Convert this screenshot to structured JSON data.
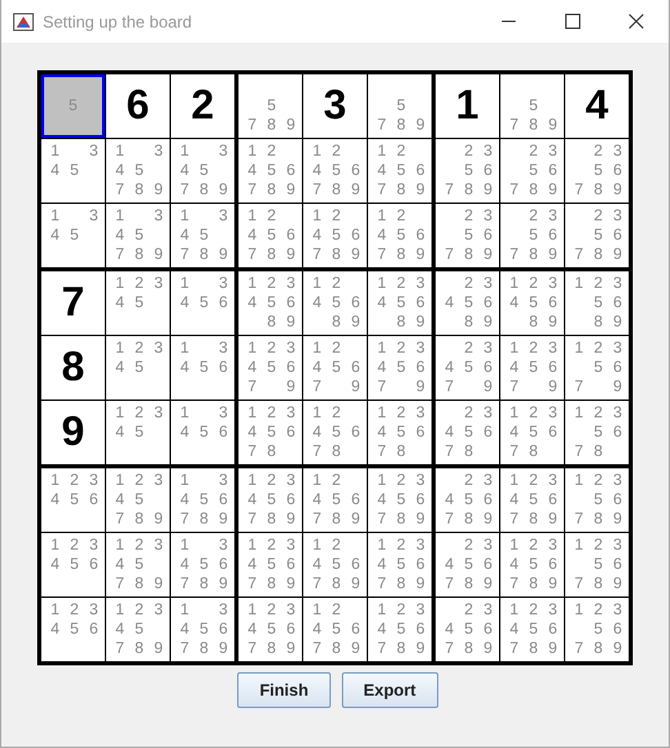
{
  "window": {
    "title": "Setting up the board"
  },
  "board": {
    "rows": [
      [
        {
          "kind": "candidates",
          "marks": [
            "5"
          ],
          "selected": true
        },
        {
          "kind": "value",
          "text": "6",
          "selected": false
        },
        {
          "kind": "value",
          "text": "2",
          "selected": false
        },
        {
          "kind": "candidates",
          "marks": [
            "5",
            "7",
            "8",
            "9"
          ],
          "selected": false
        },
        {
          "kind": "value",
          "text": "3",
          "selected": false
        },
        {
          "kind": "candidates",
          "marks": [
            "5",
            "7",
            "8",
            "9"
          ],
          "selected": false
        },
        {
          "kind": "value",
          "text": "1",
          "selected": false
        },
        {
          "kind": "candidates",
          "marks": [
            "5",
            "7",
            "8",
            "9"
          ],
          "selected": false
        },
        {
          "kind": "value",
          "text": "4",
          "selected": false
        }
      ],
      [
        {
          "kind": "candidates",
          "marks": [
            "1",
            "3",
            "4",
            "5"
          ],
          "selected": false
        },
        {
          "kind": "candidates",
          "marks": [
            "1",
            "3",
            "4",
            "5",
            "7",
            "8",
            "9"
          ],
          "selected": false
        },
        {
          "kind": "candidates",
          "marks": [
            "1",
            "3",
            "4",
            "5",
            "7",
            "8",
            "9"
          ],
          "selected": false
        },
        {
          "kind": "candidates",
          "marks": [
            "1",
            "2",
            "4",
            "5",
            "6",
            "7",
            "8",
            "9"
          ],
          "selected": false
        },
        {
          "kind": "candidates",
          "marks": [
            "1",
            "2",
            "4",
            "5",
            "6",
            "7",
            "8",
            "9"
          ],
          "selected": false
        },
        {
          "kind": "candidates",
          "marks": [
            "1",
            "2",
            "4",
            "5",
            "6",
            "7",
            "8",
            "9"
          ],
          "selected": false
        },
        {
          "kind": "candidates",
          "marks": [
            "2",
            "3",
            "5",
            "6",
            "7",
            "8",
            "9"
          ],
          "selected": false
        },
        {
          "kind": "candidates",
          "marks": [
            "2",
            "3",
            "5",
            "6",
            "7",
            "8",
            "9"
          ],
          "selected": false
        },
        {
          "kind": "candidates",
          "marks": [
            "2",
            "3",
            "5",
            "6",
            "7",
            "8",
            "9"
          ],
          "selected": false
        }
      ],
      [
        {
          "kind": "candidates",
          "marks": [
            "1",
            "3",
            "4",
            "5"
          ],
          "selected": false
        },
        {
          "kind": "candidates",
          "marks": [
            "1",
            "3",
            "4",
            "5",
            "7",
            "8",
            "9"
          ],
          "selected": false
        },
        {
          "kind": "candidates",
          "marks": [
            "1",
            "3",
            "4",
            "5",
            "7",
            "8",
            "9"
          ],
          "selected": false
        },
        {
          "kind": "candidates",
          "marks": [
            "1",
            "2",
            "4",
            "5",
            "6",
            "7",
            "8",
            "9"
          ],
          "selected": false
        },
        {
          "kind": "candidates",
          "marks": [
            "1",
            "2",
            "4",
            "5",
            "6",
            "7",
            "8",
            "9"
          ],
          "selected": false
        },
        {
          "kind": "candidates",
          "marks": [
            "1",
            "2",
            "4",
            "5",
            "6",
            "7",
            "8",
            "9"
          ],
          "selected": false
        },
        {
          "kind": "candidates",
          "marks": [
            "2",
            "3",
            "5",
            "6",
            "7",
            "8",
            "9"
          ],
          "selected": false
        },
        {
          "kind": "candidates",
          "marks": [
            "2",
            "3",
            "5",
            "6",
            "7",
            "8",
            "9"
          ],
          "selected": false
        },
        {
          "kind": "candidates",
          "marks": [
            "2",
            "3",
            "5",
            "6",
            "7",
            "8",
            "9"
          ],
          "selected": false
        }
      ],
      [
        {
          "kind": "value",
          "text": "7",
          "selected": false
        },
        {
          "kind": "candidates",
          "marks": [
            "1",
            "2",
            "3",
            "4",
            "5"
          ],
          "selected": false
        },
        {
          "kind": "candidates",
          "marks": [
            "1",
            "3",
            "4",
            "5",
            "6"
          ],
          "selected": false
        },
        {
          "kind": "candidates",
          "marks": [
            "1",
            "2",
            "3",
            "4",
            "5",
            "6",
            "8",
            "9"
          ],
          "selected": false
        },
        {
          "kind": "candidates",
          "marks": [
            "1",
            "2",
            "4",
            "5",
            "6",
            "8",
            "9"
          ],
          "selected": false
        },
        {
          "kind": "candidates",
          "marks": [
            "1",
            "2",
            "3",
            "4",
            "5",
            "6",
            "8",
            "9"
          ],
          "selected": false
        },
        {
          "kind": "candidates",
          "marks": [
            "2",
            "3",
            "4",
            "5",
            "6",
            "8",
            "9"
          ],
          "selected": false
        },
        {
          "kind": "candidates",
          "marks": [
            "1",
            "2",
            "3",
            "4",
            "5",
            "6",
            "8",
            "9"
          ],
          "selected": false
        },
        {
          "kind": "candidates",
          "marks": [
            "1",
            "2",
            "3",
            "5",
            "6",
            "8",
            "9"
          ],
          "selected": false
        }
      ],
      [
        {
          "kind": "value",
          "text": "8",
          "selected": false
        },
        {
          "kind": "candidates",
          "marks": [
            "1",
            "2",
            "3",
            "4",
            "5"
          ],
          "selected": false
        },
        {
          "kind": "candidates",
          "marks": [
            "1",
            "3",
            "4",
            "5",
            "6"
          ],
          "selected": false
        },
        {
          "kind": "candidates",
          "marks": [
            "1",
            "2",
            "3",
            "4",
            "5",
            "6",
            "7",
            "9"
          ],
          "selected": false
        },
        {
          "kind": "candidates",
          "marks": [
            "1",
            "2",
            "4",
            "5",
            "6",
            "7",
            "9"
          ],
          "selected": false
        },
        {
          "kind": "candidates",
          "marks": [
            "1",
            "2",
            "3",
            "4",
            "5",
            "6",
            "7",
            "9"
          ],
          "selected": false
        },
        {
          "kind": "candidates",
          "marks": [
            "2",
            "3",
            "4",
            "5",
            "6",
            "7",
            "9"
          ],
          "selected": false
        },
        {
          "kind": "candidates",
          "marks": [
            "1",
            "2",
            "3",
            "4",
            "5",
            "6",
            "7",
            "9"
          ],
          "selected": false
        },
        {
          "kind": "candidates",
          "marks": [
            "1",
            "2",
            "3",
            "5",
            "6",
            "7",
            "9"
          ],
          "selected": false
        }
      ],
      [
        {
          "kind": "value",
          "text": "9",
          "selected": false
        },
        {
          "kind": "candidates",
          "marks": [
            "1",
            "2",
            "3",
            "4",
            "5"
          ],
          "selected": false
        },
        {
          "kind": "candidates",
          "marks": [
            "1",
            "3",
            "4",
            "5",
            "6"
          ],
          "selected": false
        },
        {
          "kind": "candidates",
          "marks": [
            "1",
            "2",
            "3",
            "4",
            "5",
            "6",
            "7",
            "8"
          ],
          "selected": false
        },
        {
          "kind": "candidates",
          "marks": [
            "1",
            "2",
            "4",
            "5",
            "6",
            "7",
            "8"
          ],
          "selected": false
        },
        {
          "kind": "candidates",
          "marks": [
            "1",
            "2",
            "3",
            "4",
            "5",
            "6",
            "7",
            "8"
          ],
          "selected": false
        },
        {
          "kind": "candidates",
          "marks": [
            "2",
            "3",
            "4",
            "5",
            "6",
            "7",
            "8"
          ],
          "selected": false
        },
        {
          "kind": "candidates",
          "marks": [
            "1",
            "2",
            "3",
            "4",
            "5",
            "6",
            "7",
            "8"
          ],
          "selected": false
        },
        {
          "kind": "candidates",
          "marks": [
            "1",
            "2",
            "3",
            "5",
            "6",
            "7",
            "8"
          ],
          "selected": false
        }
      ],
      [
        {
          "kind": "candidates",
          "marks": [
            "1",
            "2",
            "3",
            "4",
            "5",
            "6"
          ],
          "selected": false
        },
        {
          "kind": "candidates",
          "marks": [
            "1",
            "2",
            "3",
            "4",
            "5",
            "7",
            "8",
            "9"
          ],
          "selected": false
        },
        {
          "kind": "candidates",
          "marks": [
            "1",
            "3",
            "4",
            "5",
            "6",
            "7",
            "8",
            "9"
          ],
          "selected": false
        },
        {
          "kind": "candidates",
          "marks": [
            "1",
            "2",
            "3",
            "4",
            "5",
            "6",
            "7",
            "8",
            "9"
          ],
          "selected": false
        },
        {
          "kind": "candidates",
          "marks": [
            "1",
            "2",
            "4",
            "5",
            "6",
            "7",
            "8",
            "9"
          ],
          "selected": false
        },
        {
          "kind": "candidates",
          "marks": [
            "1",
            "2",
            "3",
            "4",
            "5",
            "6",
            "7",
            "8",
            "9"
          ],
          "selected": false
        },
        {
          "kind": "candidates",
          "marks": [
            "2",
            "3",
            "4",
            "5",
            "6",
            "7",
            "8",
            "9"
          ],
          "selected": false
        },
        {
          "kind": "candidates",
          "marks": [
            "1",
            "2",
            "3",
            "4",
            "5",
            "6",
            "7",
            "8",
            "9"
          ],
          "selected": false
        },
        {
          "kind": "candidates",
          "marks": [
            "1",
            "2",
            "3",
            "5",
            "6",
            "7",
            "8",
            "9"
          ],
          "selected": false
        }
      ],
      [
        {
          "kind": "candidates",
          "marks": [
            "1",
            "2",
            "3",
            "4",
            "5",
            "6"
          ],
          "selected": false
        },
        {
          "kind": "candidates",
          "marks": [
            "1",
            "2",
            "3",
            "4",
            "5",
            "7",
            "8",
            "9"
          ],
          "selected": false
        },
        {
          "kind": "candidates",
          "marks": [
            "1",
            "3",
            "4",
            "5",
            "6",
            "7",
            "8",
            "9"
          ],
          "selected": false
        },
        {
          "kind": "candidates",
          "marks": [
            "1",
            "2",
            "3",
            "4",
            "5",
            "6",
            "7",
            "8",
            "9"
          ],
          "selected": false
        },
        {
          "kind": "candidates",
          "marks": [
            "1",
            "2",
            "4",
            "5",
            "6",
            "7",
            "8",
            "9"
          ],
          "selected": false
        },
        {
          "kind": "candidates",
          "marks": [
            "1",
            "2",
            "3",
            "4",
            "5",
            "6",
            "7",
            "8",
            "9"
          ],
          "selected": false
        },
        {
          "kind": "candidates",
          "marks": [
            "2",
            "3",
            "4",
            "5",
            "6",
            "7",
            "8",
            "9"
          ],
          "selected": false
        },
        {
          "kind": "candidates",
          "marks": [
            "1",
            "2",
            "3",
            "4",
            "5",
            "6",
            "7",
            "8",
            "9"
          ],
          "selected": false
        },
        {
          "kind": "candidates",
          "marks": [
            "1",
            "2",
            "3",
            "5",
            "6",
            "7",
            "8",
            "9"
          ],
          "selected": false
        }
      ],
      [
        {
          "kind": "candidates",
          "marks": [
            "1",
            "2",
            "3",
            "4",
            "5",
            "6"
          ],
          "selected": false
        },
        {
          "kind": "candidates",
          "marks": [
            "1",
            "2",
            "3",
            "4",
            "5",
            "7",
            "8",
            "9"
          ],
          "selected": false
        },
        {
          "kind": "candidates",
          "marks": [
            "1",
            "3",
            "4",
            "5",
            "6",
            "7",
            "8",
            "9"
          ],
          "selected": false
        },
        {
          "kind": "candidates",
          "marks": [
            "1",
            "2",
            "3",
            "4",
            "5",
            "6",
            "7",
            "8",
            "9"
          ],
          "selected": false
        },
        {
          "kind": "candidates",
          "marks": [
            "1",
            "2",
            "4",
            "5",
            "6",
            "7",
            "8",
            "9"
          ],
          "selected": false
        },
        {
          "kind": "candidates",
          "marks": [
            "1",
            "2",
            "3",
            "4",
            "5",
            "6",
            "7",
            "8",
            "9"
          ],
          "selected": false
        },
        {
          "kind": "candidates",
          "marks": [
            "2",
            "3",
            "4",
            "5",
            "6",
            "7",
            "8",
            "9"
          ],
          "selected": false
        },
        {
          "kind": "candidates",
          "marks": [
            "1",
            "2",
            "3",
            "4",
            "5",
            "6",
            "7",
            "8",
            "9"
          ],
          "selected": false
        },
        {
          "kind": "candidates",
          "marks": [
            "1",
            "2",
            "3",
            "5",
            "6",
            "7",
            "8",
            "9"
          ],
          "selected": false
        }
      ]
    ]
  },
  "buttons": [
    "Finish",
    "Export"
  ]
}
